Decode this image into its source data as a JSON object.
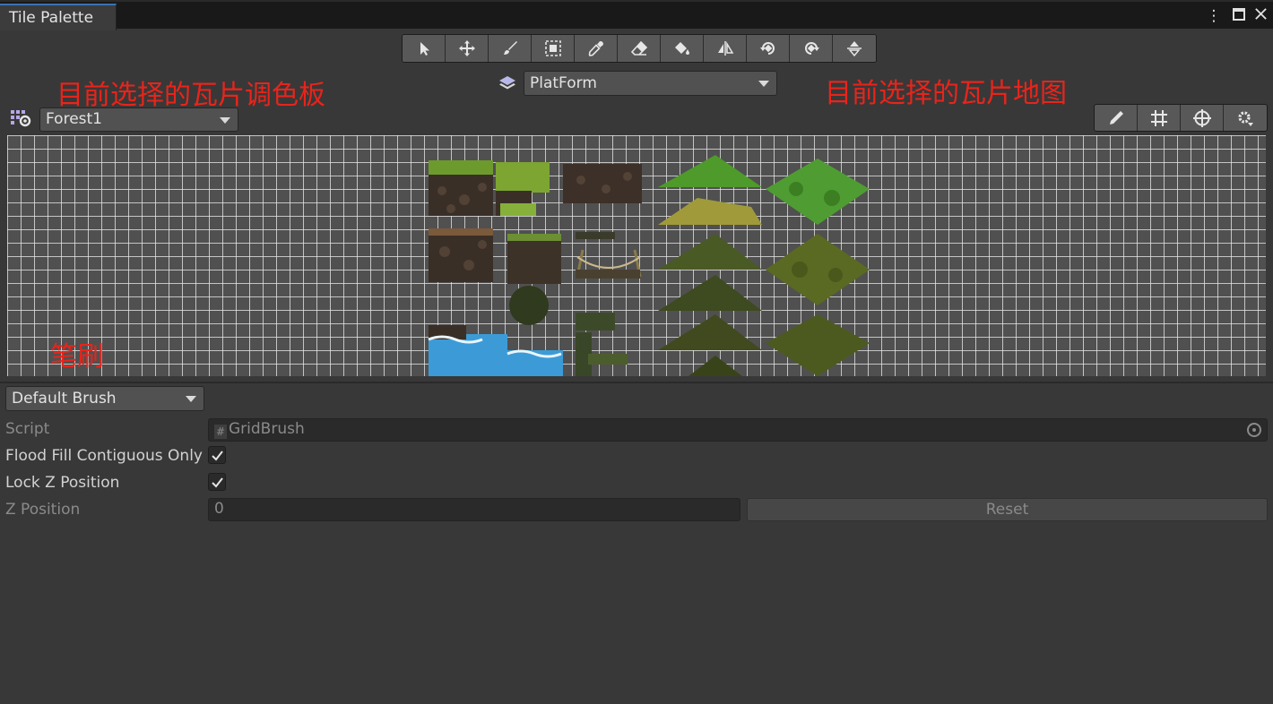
{
  "window": {
    "tab_title": "Tile Palette",
    "controls": {
      "menu": "⋮",
      "maximize": "□",
      "close": "✕"
    }
  },
  "toolbar": {
    "tools": [
      {
        "name": "select-icon"
      },
      {
        "name": "move-icon"
      },
      {
        "name": "paint-brush-icon"
      },
      {
        "name": "box-fill-icon"
      },
      {
        "name": "pick-eyedropper-icon"
      },
      {
        "name": "erase-icon"
      },
      {
        "name": "flood-fill-icon"
      },
      {
        "name": "flip-x-icon"
      },
      {
        "name": "rotate-clockwise-icon"
      },
      {
        "name": "rotate-counterclockwise-icon"
      },
      {
        "name": "flip-y-icon"
      }
    ]
  },
  "active_tilemap": {
    "value": "PlatForm"
  },
  "palette": {
    "value": "Forest1"
  },
  "annotations": {
    "palette": "目前选择的瓦片调色板",
    "tilemap": "目前选择的瓦片地图",
    "brush": "笔刷"
  },
  "palette_tools": [
    {
      "name": "edit-pencil-icon"
    },
    {
      "name": "grid-icon"
    },
    {
      "name": "gizmos-icon"
    },
    {
      "name": "settings-icon"
    }
  ],
  "brush": {
    "dropdown_value": "Default Brush",
    "script_label": "Script",
    "script_value": "GridBrush",
    "flood_fill_label": "Flood Fill Contiguous Only",
    "flood_fill_checked": true,
    "lock_z_label": "Lock Z Position",
    "lock_z_checked": true,
    "z_position_label": "Z Position",
    "z_position_value": "0",
    "reset_label": "Reset"
  },
  "colors": {
    "annotation_red": "#e8241b",
    "accent_blue": "#3a72b0",
    "panel_bg": "#383838"
  }
}
